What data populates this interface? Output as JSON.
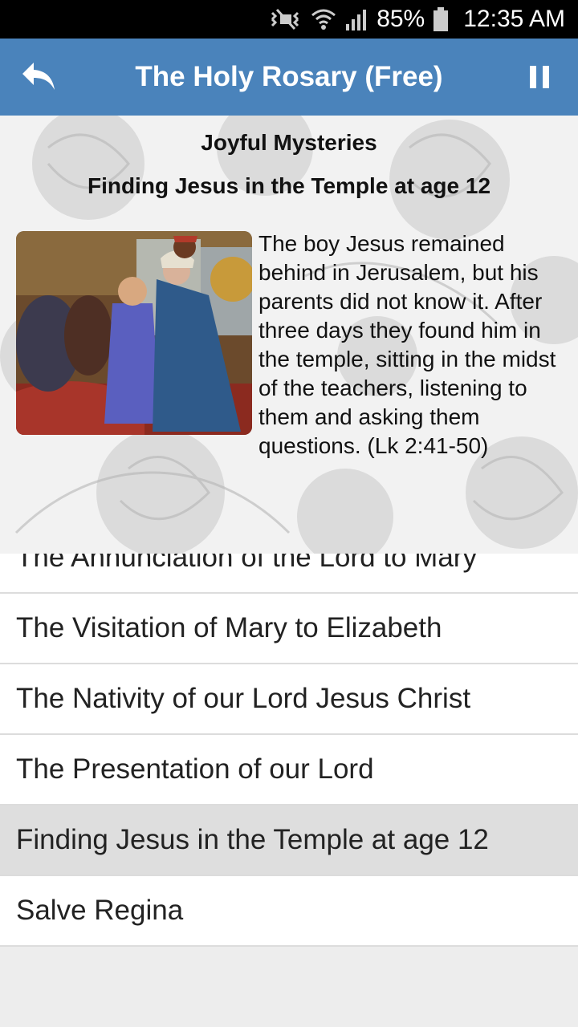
{
  "status_bar": {
    "battery": "85%",
    "time": "12:35 AM",
    "icons": [
      "mute-icon",
      "wifi-icon",
      "signal-icon",
      "battery-icon"
    ]
  },
  "app_bar": {
    "title": "The Holy Rosary (Free)",
    "back_icon": "reply-arrow-icon",
    "pause_icon": "pause-icon",
    "color": "#4a83bb"
  },
  "mystery": {
    "group": "Joyful Mysteries",
    "title": "Finding Jesus in the Temple at age 12",
    "text": "The boy Jesus remained behind in Jerusalem, but his parents did not know it. After three days they found him in the temple, sitting in the midst of the teachers, listening to them and asking them questions. (Lk 2:41-50)"
  },
  "list": {
    "items": [
      "The Annunciation of the Lord to Mary",
      "The Visitation of Mary to Elizabeth",
      "The Nativity of our Lord Jesus Christ",
      "The Presentation of our Lord",
      "Finding Jesus in the Temple at age 12",
      "Salve Regina"
    ],
    "selected_index": 4
  }
}
